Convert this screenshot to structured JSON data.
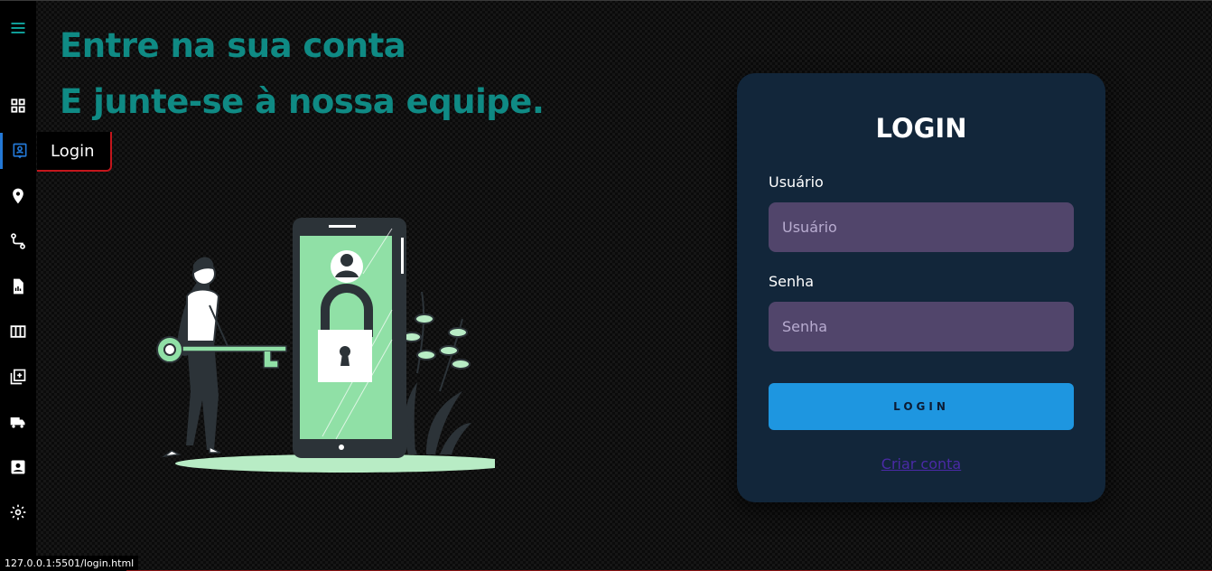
{
  "sidebar": {
    "items": [
      {
        "icon": "menu-icon",
        "label": "Menu"
      },
      {
        "icon": "grid-icon",
        "label": "Dashboard"
      },
      {
        "icon": "contact-icon",
        "label": "Login"
      },
      {
        "icon": "location-pin-icon",
        "label": "Location"
      },
      {
        "icon": "route-icon",
        "label": "Route"
      },
      {
        "icon": "report-icon",
        "label": "Report"
      },
      {
        "icon": "table-icon",
        "label": "Table"
      },
      {
        "icon": "add-box-icon",
        "label": "Add"
      },
      {
        "icon": "truck-icon",
        "label": "Truck"
      },
      {
        "icon": "account-box-icon",
        "label": "Account"
      },
      {
        "icon": "gear-icon",
        "label": "Settings"
      }
    ],
    "tooltip": "Login"
  },
  "headline": {
    "line1": "Entre na sua conta",
    "line2": "E junte-se à nossa equipe."
  },
  "login": {
    "title": "LOGIN",
    "username_label": "Usuário",
    "username_placeholder": "Usuário",
    "username_value": "",
    "password_label": "Senha",
    "password_placeholder": "Senha",
    "password_value": "",
    "button_label": "LOGIN",
    "create_account": "Criar conta"
  },
  "status_url": "127.0.0.1:5501/login.html",
  "colors": {
    "accent": "#0f8a84",
    "card": "#12263a",
    "input": "#51456b",
    "button": "#1e96e0",
    "link": "#4a2aa6",
    "tooltip_border": "#c4161c"
  }
}
